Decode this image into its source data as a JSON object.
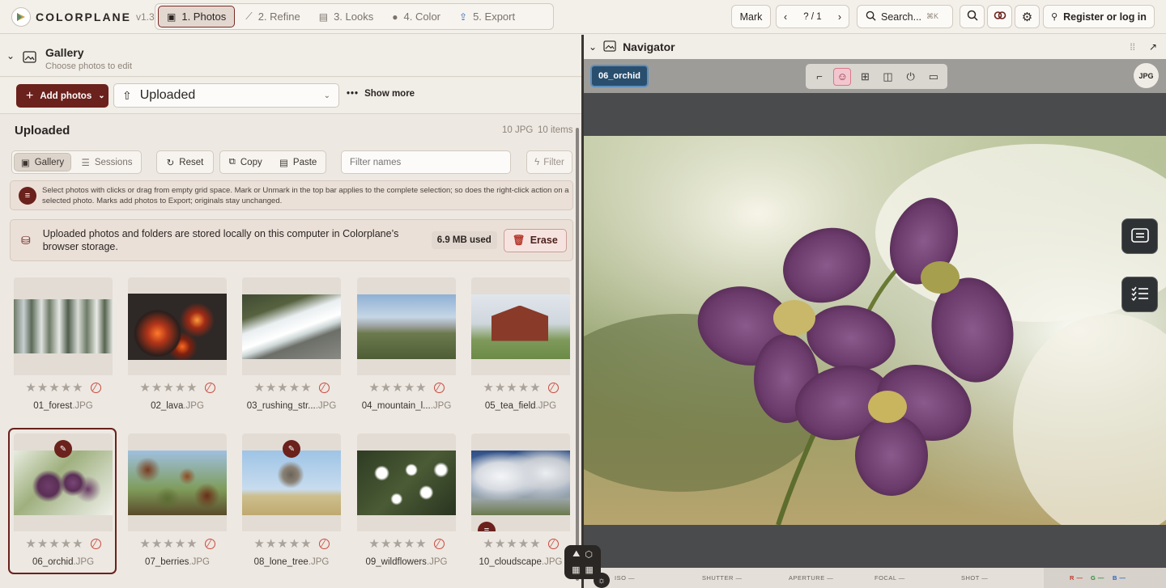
{
  "app": {
    "name": "COLORPLANE",
    "version": "v1.3"
  },
  "steps": [
    {
      "label": "1. Photos",
      "active": true
    },
    {
      "label": "2. Refine"
    },
    {
      "label": "3. Looks"
    },
    {
      "label": "4. Color"
    },
    {
      "label": "5. Export"
    }
  ],
  "topbar": {
    "mark_label": "Mark",
    "page_counter": "? / 1",
    "search_label": "Search...",
    "search_shortcut": "⌘K",
    "register_label": "Register or log in"
  },
  "gallery": {
    "title": "Gallery",
    "subtitle": "Choose photos to edit",
    "add_photos_label": "Add photos",
    "source_select": "Uploaded",
    "show_more_label": "Show more",
    "section_title": "Uploaded",
    "count_jpg": "10 JPG",
    "count_items": "10 items",
    "view_tabs": [
      "Gallery",
      "Sessions"
    ],
    "reset_label": "Reset",
    "copy_label": "Copy",
    "paste_label": "Paste",
    "filter_placeholder": "Filter names",
    "filter_button": "Filter",
    "hint_text": "Select photos with clicks or drag from empty grid space. Mark or Unmark in the top bar applies to the complete selection; so does the right-click action on a selected photo. Marks add photos to Export; originals stay unchanged.",
    "storage_text": "Uploaded photos and folders are stored locally on this computer in Colorplane’s browser storage.",
    "storage_used": "6.9 MB used",
    "erase_label": "Erase",
    "photos": [
      {
        "name": "01_forest",
        "ext": ".JPG",
        "stars": "★★★★★"
      },
      {
        "name": "02_lava",
        "ext": ".JPG",
        "stars": "★★★★★"
      },
      {
        "name": "03_rushing_str...",
        "ext": ".JPG",
        "stars": "★★★★★"
      },
      {
        "name": "04_mountain_l...",
        "ext": ".JPG",
        "stars": "★★★★★"
      },
      {
        "name": "05_tea_field",
        "ext": ".JPG",
        "stars": "★★★★★"
      },
      {
        "name": "06_orchid",
        "ext": ".JPG",
        "stars": "★★★★★",
        "selected": true,
        "edited": true
      },
      {
        "name": "07_berries",
        "ext": ".JPG",
        "stars": "★★★★★"
      },
      {
        "name": "08_lone_tree",
        "ext": ".JPG",
        "stars": "★★★★★",
        "edited": true
      },
      {
        "name": "09_wildflowers",
        "ext": ".JPG",
        "stars": "★★★★★"
      },
      {
        "name": "10_cloudscape",
        "ext": ".JPG",
        "stars": "★★★★★",
        "marked": true
      }
    ]
  },
  "navigator": {
    "title": "Navigator",
    "file_tag": "06_orchid",
    "format_tag": "JPG",
    "exif": {
      "iso": "ISO —",
      "shutter": "SHUTTER —",
      "aperture": "APERTURE —",
      "focal": "FOCAL —",
      "shot": "SHOT —",
      "r": "R —",
      "g": "G —",
      "b": "B —"
    }
  },
  "colors": {
    "accent": "#6b211c",
    "navigator_tag": "#2a4f6e",
    "panel_bg": "#ede8e2"
  }
}
